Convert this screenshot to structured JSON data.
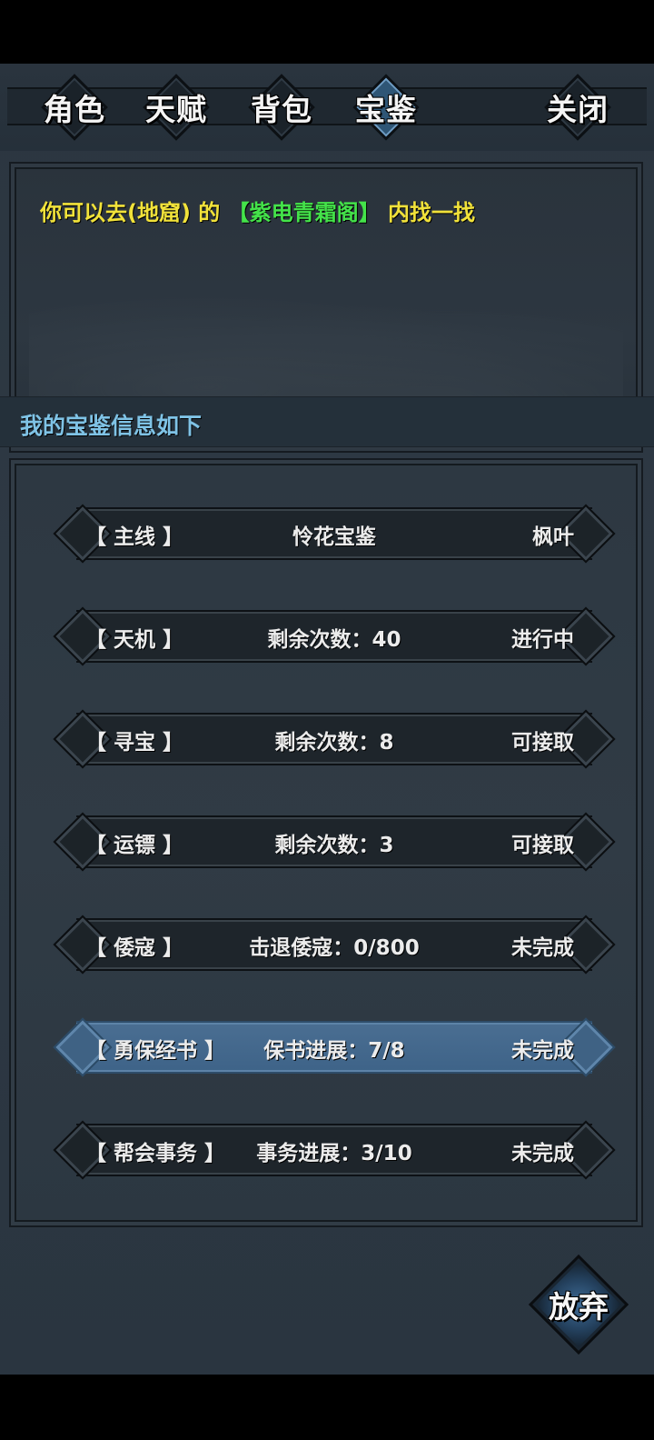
{
  "tabs": [
    {
      "label": "角色",
      "active": false
    },
    {
      "label": "天赋",
      "active": false
    },
    {
      "label": "背包",
      "active": false
    },
    {
      "label": "宝鉴",
      "active": true
    }
  ],
  "close_label": "关闭",
  "hint": {
    "prefix": "你可以去",
    "place": "(地窟)",
    "connector": "的",
    "target": "【紫电青霜阁】",
    "suffix": "内找一找"
  },
  "section_title": "我的宝鉴信息如下",
  "rows": [
    {
      "category": "【 主线 】",
      "detail": "怜花宝鉴",
      "status": "枫叶",
      "selected": false
    },
    {
      "category": "【 天机 】",
      "detail": "剩余次数：40",
      "status": "进行中",
      "selected": false
    },
    {
      "category": "【 寻宝 】",
      "detail": "剩余次数：8",
      "status": "可接取",
      "selected": false
    },
    {
      "category": "【 运镖 】",
      "detail": "剩余次数：3",
      "status": "可接取",
      "selected": false
    },
    {
      "category": "【 倭寇 】",
      "detail": "击退倭寇：0/800",
      "status": "未完成",
      "selected": false
    },
    {
      "category": "【 勇保经书 】",
      "detail": "保书进展：7/8",
      "status": "未完成",
      "selected": true
    },
    {
      "category": "【 帮会事务 】",
      "detail": "事务进展：3/10",
      "status": "未完成",
      "selected": false
    }
  ],
  "abandon_label": "放弃",
  "colors": {
    "hint_yellow": "#f1e23a",
    "hint_green": "#44e34a",
    "section_title": "#7fc3e6",
    "selected_row": "#4a6e92"
  }
}
